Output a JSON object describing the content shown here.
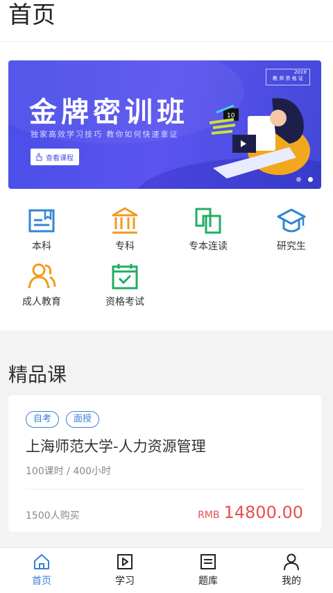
{
  "header": {
    "title": "首页"
  },
  "banner": {
    "title": "金牌密训班",
    "subtitle": "独家高效学习技巧   教你如何快速拿证",
    "cta_label": "查看课程",
    "badge_year": "2019",
    "badge_text": "教 师 资 格 证",
    "calendar_number": "10",
    "slide_index": 2,
    "slide_count": 2
  },
  "categories": [
    {
      "label": "本科",
      "icon": "book-icon",
      "color": "#2f86d6"
    },
    {
      "label": "专科",
      "icon": "institution-icon",
      "color": "#f29a1d"
    },
    {
      "label": "专本连读",
      "icon": "linked-squares-icon",
      "color": "#1fae62"
    },
    {
      "label": "研究生",
      "icon": "graduation-cap-icon",
      "color": "#2f86d6"
    },
    {
      "label": "成人教育",
      "icon": "users-icon",
      "color": "#f29a1d"
    },
    {
      "label": "资格考试",
      "icon": "calendar-check-icon",
      "color": "#1fae62"
    }
  ],
  "section": {
    "title": "精品课"
  },
  "course": {
    "tags": [
      "自考",
      "面授"
    ],
    "title": "上海师范大学-人力资源管理",
    "meta": "100课时 / 400小时",
    "buyers": "1500人购买",
    "currency": "RMB",
    "price": "14800.00"
  },
  "tabbar": {
    "active": "首页",
    "items": [
      {
        "label": "首页",
        "icon": "home-icon"
      },
      {
        "label": "学习",
        "icon": "play-square-icon"
      },
      {
        "label": "题库",
        "icon": "document-list-icon"
      },
      {
        "label": "我的",
        "icon": "user-icon"
      }
    ]
  },
  "colors": {
    "accent": "#3a7ed8",
    "price": "#e94e4e",
    "banner": "#4a4ee8"
  }
}
